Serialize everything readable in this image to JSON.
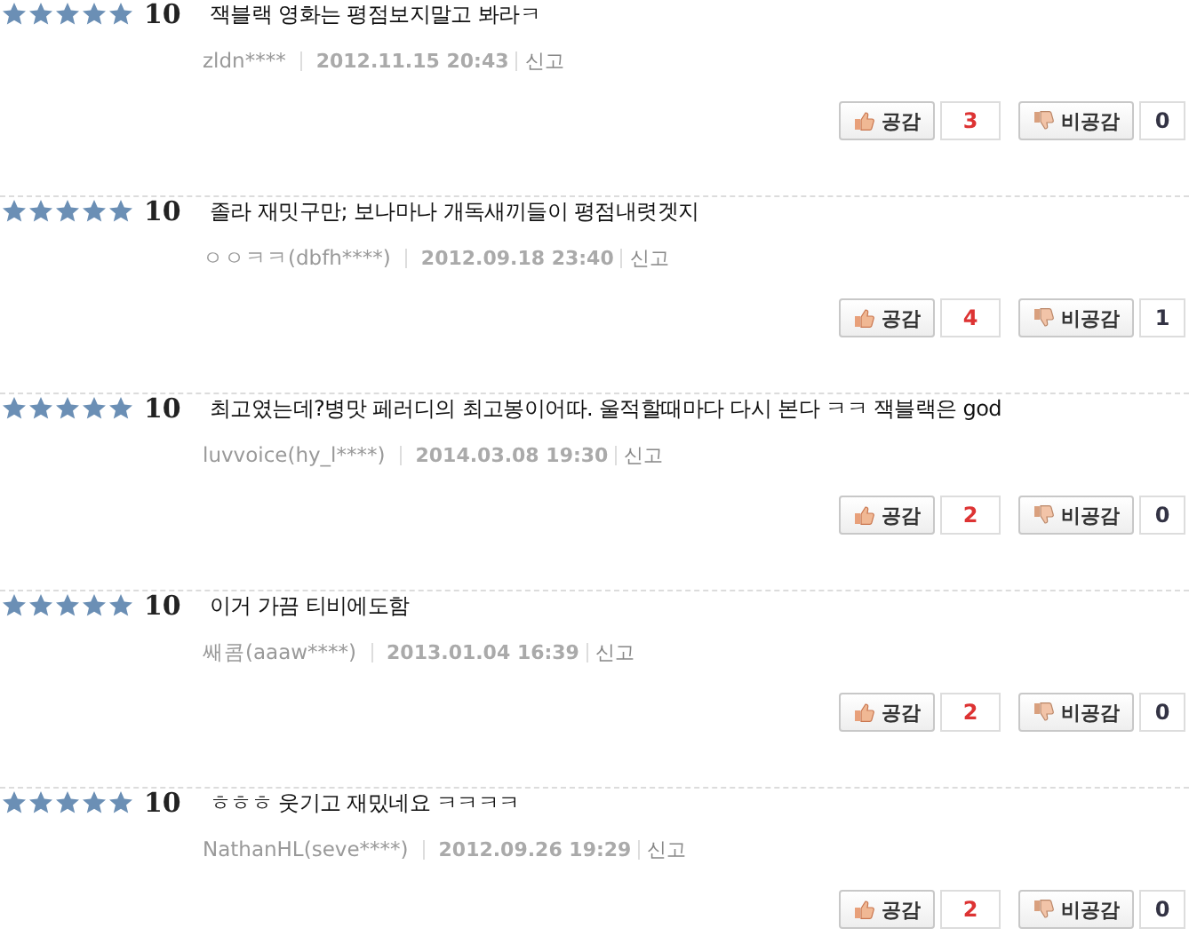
{
  "reviews": [
    {
      "stars": 5,
      "score": "10",
      "text": "잭블랙 영화는 평점보지말고 봐라ㅋ",
      "author": "zldn****",
      "date": "2012.11.15 20:43",
      "report": "신고",
      "like_label": "공감",
      "likes": "3",
      "dislike_label": "비공감",
      "dislikes": "0"
    },
    {
      "stars": 5,
      "score": "10",
      "text": "졸라 재밋구만; 보나마나 개독새끼들이 평점내렷겟지",
      "author": "ㅇㅇㅋㅋ(dbfh****)",
      "date": "2012.09.18 23:40",
      "report": "신고",
      "like_label": "공감",
      "likes": "4",
      "dislike_label": "비공감",
      "dislikes": "1"
    },
    {
      "stars": 5,
      "score": "10",
      "text": "최고였는데?병맛 페러디의 최고봉이어따. 울적할때마다 다시 본다 ㅋㅋ 잭블랙은 god",
      "author": "luvvoice(hy_l****)",
      "date": "2014.03.08 19:30",
      "report": "신고",
      "like_label": "공감",
      "likes": "2",
      "dislike_label": "비공감",
      "dislikes": "0"
    },
    {
      "stars": 5,
      "score": "10",
      "text": "이거 가끔 티비에도함",
      "author": "쌔콤(aaaw****)",
      "date": "2013.01.04 16:39",
      "report": "신고",
      "like_label": "공감",
      "likes": "2",
      "dislike_label": "비공감",
      "dislikes": "0"
    },
    {
      "stars": 5,
      "score": "10",
      "text": "ㅎㅎㅎ 웃기고 재밌네요 ㅋㅋㅋㅋ",
      "author": "NathanHL(seve****)",
      "date": "2012.09.26 19:29",
      "report": "신고",
      "like_label": "공감",
      "likes": "2",
      "dislike_label": "비공감",
      "dislikes": "0"
    }
  ]
}
